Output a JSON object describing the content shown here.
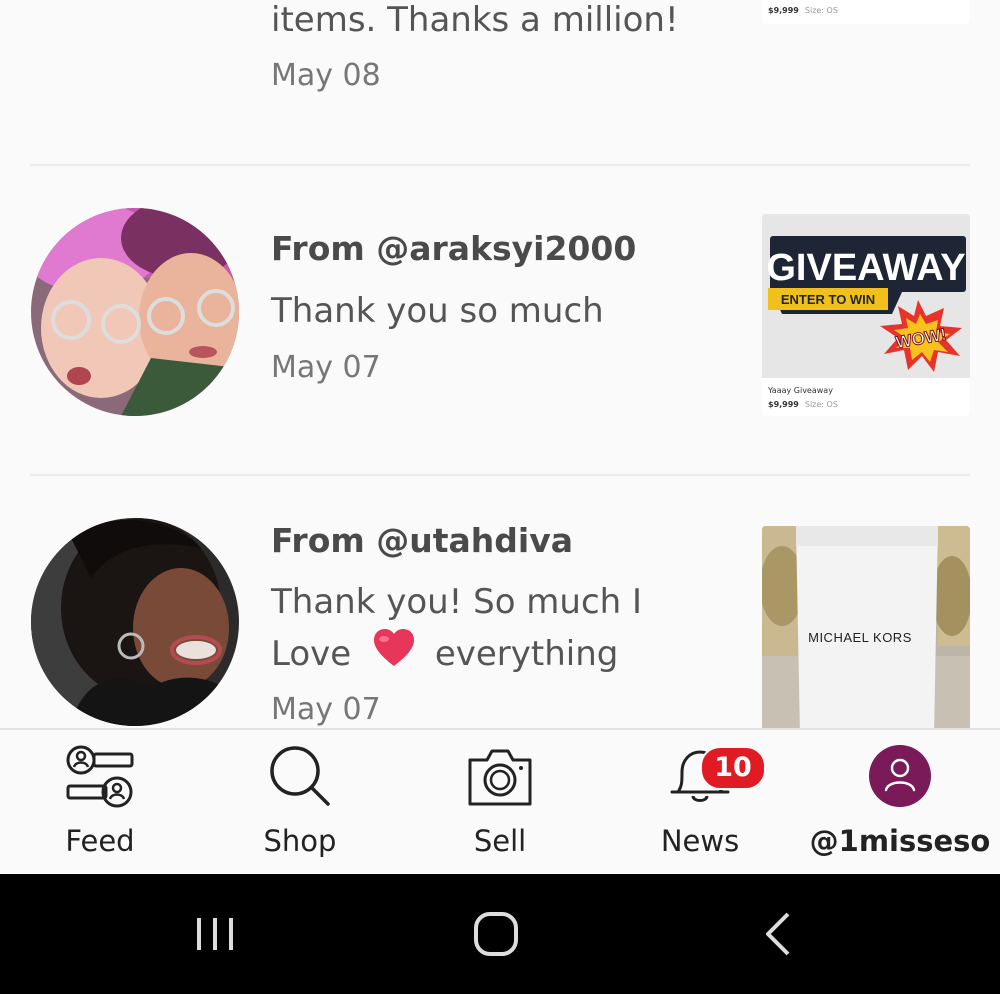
{
  "notifications": [
    {
      "message": "items. Thanks a million!",
      "date": "May 08",
      "thumb": {
        "price": "$9,999",
        "size": "Size: OS"
      }
    },
    {
      "from": "From @araksyi2000",
      "message_lines": [
        "Thank you so much"
      ],
      "date": "May 07",
      "thumb": {
        "headline": "GIVEAWAY",
        "ribbon": "ENTER TO WIN",
        "burst": "WOW!",
        "title": "Yaaay Giveaway",
        "price": "$9,999",
        "size": "Size: OS"
      }
    },
    {
      "from": "From @utahdiva",
      "message_lines": [
        "Thank you! So much I",
        "Love",
        "everything"
      ],
      "date": "May 07",
      "thumb": {
        "brand": "MICHAEL KORS"
      }
    }
  ],
  "tabs": [
    {
      "label": "Feed",
      "icon": "feed-icon"
    },
    {
      "label": "Shop",
      "icon": "search-icon"
    },
    {
      "label": "Sell",
      "icon": "camera-icon"
    },
    {
      "label": "News",
      "icon": "bell-icon",
      "badge": "10"
    },
    {
      "label": "@1misseso",
      "icon": "profile-icon"
    }
  ],
  "colors": {
    "badge": "#e01b24",
    "profile": "#7a1a58",
    "heart": "#e8355a"
  },
  "system_nav": [
    "recent-apps-icon",
    "home-icon",
    "back-icon"
  ]
}
